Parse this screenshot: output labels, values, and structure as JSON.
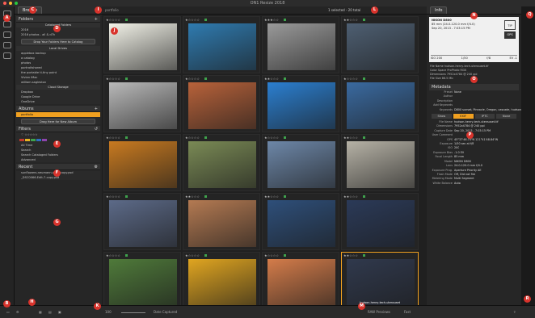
{
  "window": {
    "title": "ON1 Resize 2018"
  },
  "left": {
    "tab": "Browse",
    "folders_title": "Folders",
    "cataloged_title": "Cataloged Folders",
    "cataloged": [
      "2016",
      "2016 photos - all & d7k"
    ],
    "drop_catalog": "Drop Your Folders Here to Catalog",
    "local_title": "Local Drives",
    "local": [
      "applebox backup",
      "a catalog",
      "photos",
      "portraitshared",
      "the portable ti-tiny point",
      "Vivian iMac",
      "william.sagleston"
    ],
    "cloud_title": "Cloud Storage",
    "cloud": [
      "Dropbox",
      "Google Drive",
      "OneDrive"
    ],
    "albums_title": "Albums",
    "album_selected": "portfolio",
    "drop_album": "Drag Here for New Album",
    "filters_title": "Filters",
    "filter_all": "All Time",
    "filter_search_placeholder": "Search",
    "filter_options": [
      "Search Cataloged Folders",
      "Advanced"
    ],
    "recent_title": "Recent",
    "recent": [
      "sunflowers-neumann-color-copy.psd",
      "_DSC0066-Edit-7-copy.psd"
    ]
  },
  "center": {
    "path": "portfolio",
    "selection_status": "1 selected - 20 total",
    "tiles": [
      {
        "stars": "★☆☆☆☆",
        "label": "",
        "color": "#f2f2e8"
      },
      {
        "stars": "★☆☆☆☆",
        "label": "",
        "color": "#2f7bb0"
      },
      {
        "stars": "★★★☆☆",
        "label": "",
        "color": "#9a9a9a"
      },
      {
        "stars": "★★☆☆☆",
        "label": "",
        "color": "#4e5f72"
      },
      {
        "stars": "★☆☆☆☆",
        "label": "",
        "color": "#b9b9b9"
      },
      {
        "stars": "★☆☆☆☆",
        "label": "",
        "color": "#b8623a"
      },
      {
        "stars": "★★☆☆☆",
        "label": "",
        "color": "#2b7fd0"
      },
      {
        "stars": "★☆☆☆☆",
        "label": "",
        "color": "#3a6aa0"
      },
      {
        "stars": "★☆☆☆☆",
        "label": "",
        "color": "#c87a20"
      },
      {
        "stars": "★☆☆☆☆",
        "label": "",
        "color": "#7a8a55"
      },
      {
        "stars": "★☆☆☆☆",
        "label": "",
        "color": "#6d87a8"
      },
      {
        "stars": "★★☆☆☆",
        "label": "",
        "color": "#b6b2a6"
      },
      {
        "stars": "★☆☆☆☆",
        "label": "",
        "color": "#5c6a88"
      },
      {
        "stars": "★★☆☆☆",
        "label": "",
        "color": "#b47a52"
      },
      {
        "stars": "★★☆☆☆",
        "label": "",
        "color": "#2e4f7a"
      },
      {
        "stars": "★★☆☆☆",
        "label": "",
        "color": "#2b3a58"
      },
      {
        "stars": "★☆☆☆☆",
        "label": "",
        "color": "#4f7a3a"
      },
      {
        "stars": "★☆☆☆☆",
        "label": "",
        "color": "#e0a520"
      },
      {
        "stars": "★☆☆☆☆",
        "label": "",
        "color": "#d47c4a"
      },
      {
        "stars": "★★☆☆☆",
        "label": "hudson-henry-tech-utensuset",
        "color": "#30394d"
      }
    ]
  },
  "right": {
    "tab": "Info",
    "camera": "NIKON D800",
    "lens": "85 mm (24.0-120.0 mm f/4.0)",
    "date": "Sep 20, 2013 - 7:03:15 PM",
    "tip": "TIP",
    "gps": "GPS",
    "exif": [
      "ISO 200",
      "1/50",
      "f/8",
      "EV -1"
    ],
    "file_name_line": "File Name hudson-henry-tech-utensuset.tif",
    "color_space": "Color Space ProPhoto RGB",
    "dimensions": "Dimensions 7952x4784 @ 240 ppi",
    "file_size": "File Size 86.5 Mb",
    "metadata_title": "Metadata",
    "meta": [
      {
        "k": "Preset",
        "v": "None"
      },
      {
        "k": "Author",
        "v": ""
      },
      {
        "k": "Description",
        "v": ""
      },
      {
        "k": "Add Keywords",
        "v": ""
      },
      {
        "k": "Keywords",
        "v": "D800 sunset, Pinnacle, Oregon, cascade, hudson-henry, mount-hood, oregon"
      }
    ],
    "mtabs": [
      "Show",
      "EXIF",
      "IPTC",
      "None"
    ],
    "exif_rows": [
      {
        "k": "File Name",
        "v": "hudson-henry-tech-utensuset.tif"
      },
      {
        "k": "Dimensions",
        "v": "7952x4784 @ 240 ppi"
      },
      {
        "k": "Capture Date",
        "v": "Sep 20, 2013 - 7:03:15 PM"
      },
      {
        "k": "User Comment",
        "v": ""
      },
      {
        "k": "GPS",
        "v": "45°37'46.74\"N 121°41'48.84\"W"
      },
      {
        "k": "Exposure",
        "v": "1/50 sec at f/8"
      },
      {
        "k": "ISO",
        "v": "200"
      },
      {
        "k": "Exposure Bias",
        "v": "-1.0 EV"
      },
      {
        "k": "Focal Length",
        "v": "85 mm"
      },
      {
        "k": "Model",
        "v": "NIKON D800"
      },
      {
        "k": "Lens",
        "v": "24.0-120.0 mm f/4.0"
      },
      {
        "k": "Exposure Prog.",
        "v": "Aperture Priority AE"
      },
      {
        "k": "Flash Mode",
        "v": "Off, Did not fire"
      },
      {
        "k": "Metering Mode",
        "v": "Multi Segment"
      },
      {
        "k": "White Balance",
        "v": "Auto"
      }
    ]
  },
  "bottom": {
    "zoom": "100",
    "sort": "Date Captured",
    "preview": "RAW Previews",
    "preview_mode": "Fast"
  },
  "colors": {
    "accent": "#f0a020",
    "marker": "#d9332c",
    "green_label": "#3fa34d"
  },
  "markers": [
    "A",
    "B",
    "C",
    "D",
    "E",
    "F",
    "G",
    "H",
    "I",
    "J",
    "K",
    "L",
    "M",
    "N",
    "O",
    "P",
    "Q",
    "R"
  ]
}
